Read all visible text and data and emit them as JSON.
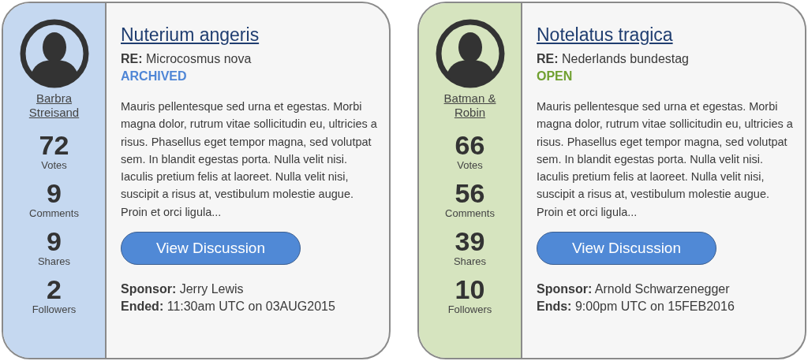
{
  "cards": [
    {
      "kind": "archived",
      "author": [
        "Barbra",
        "Streisand"
      ],
      "stats": [
        {
          "value": "72",
          "label": "Votes"
        },
        {
          "value": "9",
          "label": "Comments"
        },
        {
          "value": "9",
          "label": "Shares"
        },
        {
          "value": "2",
          "label": "Followers"
        }
      ],
      "title": "Nuterium angeris",
      "re": "**RE:** Microcosmus nova",
      "status": {
        "label": "ARCHIVED",
        "color": "#4f86d6"
      },
      "body": "Mauris pellentesque sed urna et egestas. Morbi magna dolor, rutrum vitae sollicitudin eu, ultricies a risus. Phasellus eget tempor magna, sed volutpat sem. In blandit egestas porta. Nulla velit nisi. Iaculis pretium felis at laoreet. Nulla velit nisi, suscipit a risus at, vestibulum molestie augue. Proin et orci ligula...",
      "button": "View Discussion",
      "footer": [
        "**Sponsor:** Jerry Lewis",
        "**Ended:** 11:30am UTC on 03AUG2015"
      ]
    },
    {
      "kind": "open",
      "author": [
        "Batman &",
        "Robin"
      ],
      "stats": [
        {
          "value": "66",
          "label": "Votes"
        },
        {
          "value": "56",
          "label": "Comments"
        },
        {
          "value": "39",
          "label": "Shares"
        },
        {
          "value": "10",
          "label": "Followers"
        }
      ],
      "title": "Notelatus tragica",
      "re": "**RE:** Nederlands bundestag",
      "status": {
        "label": "OPEN",
        "color": "#70a030"
      },
      "body": "Mauris pellentesque sed urna et egestas. Morbi magna dolor, rutrum vitae sollicitudin eu, ultricies a risus. Phasellus eget tempor magna, sed volutpat sem. In blandit egestas porta. Nulla velit nisi. Iaculis pretium felis at laoreet. Nulla velit nisi, suscipit a risus at, vestibulum molestie augue. Proin et orci ligula...",
      "button": "View Discussion",
      "footer": [
        "**Sponsor:** Arnold Schwarzenegger",
        "**Ends:** 9:00pm UTC on 15FEB2016"
      ]
    }
  ]
}
